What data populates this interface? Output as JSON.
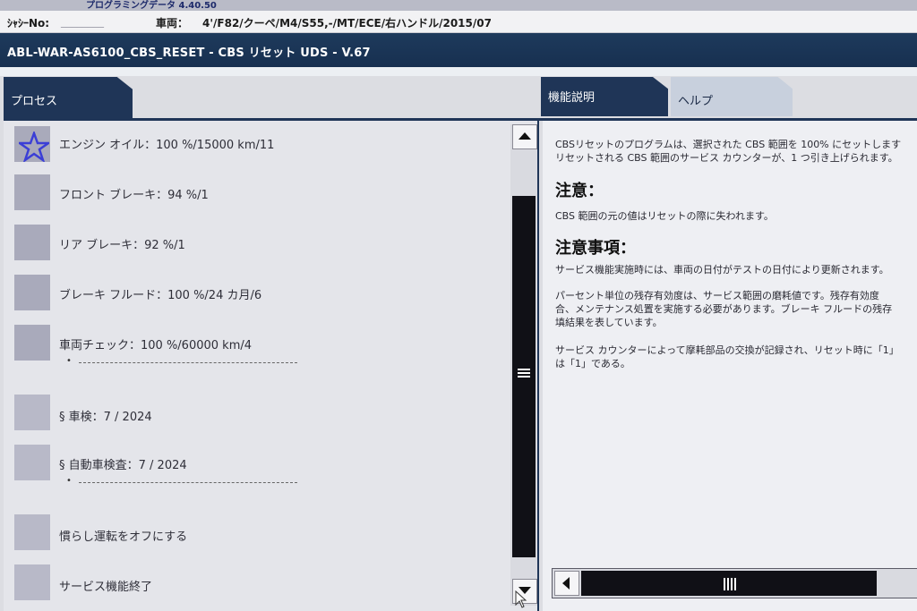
{
  "header": {
    "program_label": "プログラミングデータ  4.40.50",
    "chassis_label": "ｼｬｼｰNo:",
    "chassis_value": "________",
    "vehicle_label": "車両：",
    "vehicle_value": "4'/F82/クーペ/M4/S55,-/MT/ECE/右ハンドル/2015/07",
    "title": "ABL-WAR-AS6100_CBS_RESET - CBS リセット UDS - V.67"
  },
  "tabs": {
    "process": "プロセス",
    "function": "機能説明",
    "help": "ヘルプ"
  },
  "items": [
    {
      "label": "エンジン オイル：100 %/15000 km/11",
      "icon": "star-icon"
    },
    {
      "label": "フロント ブレーキ：94 %/1"
    },
    {
      "label": "リア ブレーキ：92 %/1"
    },
    {
      "label": "ブレーキ フルード：100 %/24 カ月/6"
    },
    {
      "label": "車両チェック：100 %/60000 km/4",
      "bullet": "•"
    },
    {
      "label": "§ 車検：7 / 2024"
    },
    {
      "label": "§ 自動車検査：7 / 2024",
      "bullet": "•"
    },
    {
      "label": "慣らし運転をオフにする"
    },
    {
      "label": "サービス機能終了"
    }
  ],
  "description": {
    "line1": "CBSリセットのプログラムは、選択された CBS 範囲を 100% にセットします",
    "line2": "リセットされる CBS 範囲のサービス カウンターが、1 つ引き上げられます。",
    "heading1": "注意：",
    "note1": "CBS 範囲の元の値はリセットの際に失われます。",
    "heading2": "注意事項：",
    "p1": "サービス機能実施時には、車両の日付がテストの日付により更新されます。",
    "p2_l1": "パーセント単位の残存有効度は、サービス範囲の磨耗値です。残存有効度",
    "p2_l2": "合、メンテナンス処置を実施する必要があります。ブレーキ フルードの残存",
    "p2_l3": "填結果を表しています。",
    "p3_l1": "サービス カウンターによって摩耗部品の交換が記録され、リセット時に「1」",
    "p3_l2": "は「1」である。"
  }
}
